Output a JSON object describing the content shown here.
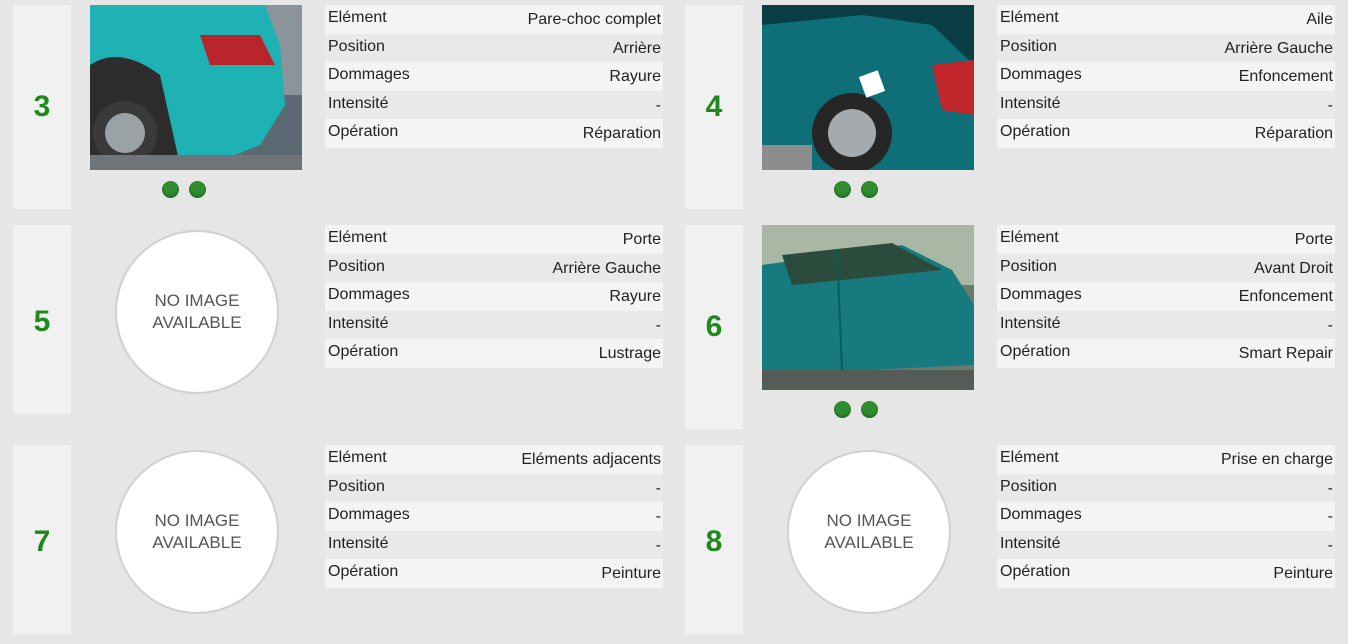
{
  "colors": {
    "accent": "#1e8a1e",
    "dot": "#2e8b2e"
  },
  "no_image": {
    "line1": "NO IMAGE",
    "line2": "AVAILABLE"
  },
  "cards": [
    {
      "number": "3",
      "has_photo": true,
      "photo_dots": 2,
      "rows": [
        {
          "label": "Elément",
          "value": "Pare-choc complet"
        },
        {
          "label": "Position",
          "value": "Arrière"
        },
        {
          "label": "Dommages",
          "value": "Rayure"
        },
        {
          "label": "Intensité",
          "value": "-"
        },
        {
          "label": "Opération",
          "value": "Réparation"
        }
      ]
    },
    {
      "number": "4",
      "has_photo": true,
      "photo_dots": 2,
      "rows": [
        {
          "label": "Elément",
          "value": "Aile"
        },
        {
          "label": "Position",
          "value": "Arrière Gauche"
        },
        {
          "label": "Dommages",
          "value": "Enfoncement"
        },
        {
          "label": "Intensité",
          "value": "-"
        },
        {
          "label": "Opération",
          "value": "Réparation"
        }
      ]
    },
    {
      "number": "5",
      "has_photo": false,
      "rows": [
        {
          "label": "Elément",
          "value": "Porte"
        },
        {
          "label": "Position",
          "value": "Arrière Gauche"
        },
        {
          "label": "Dommages",
          "value": "Rayure"
        },
        {
          "label": "Intensité",
          "value": "-"
        },
        {
          "label": "Opération",
          "value": "Lustrage"
        }
      ]
    },
    {
      "number": "6",
      "has_photo": true,
      "photo_dots": 2,
      "rows": [
        {
          "label": "Elément",
          "value": "Porte"
        },
        {
          "label": "Position",
          "value": "Avant Droit"
        },
        {
          "label": "Dommages",
          "value": "Enfoncement"
        },
        {
          "label": "Intensité",
          "value": "-"
        },
        {
          "label": "Opération",
          "value": "Smart Repair"
        }
      ]
    },
    {
      "number": "7",
      "has_photo": false,
      "rows": [
        {
          "label": "Elément",
          "value": "Eléments adjacents"
        },
        {
          "label": "Position",
          "value": "-"
        },
        {
          "label": "Dommages",
          "value": "-"
        },
        {
          "label": "Intensité",
          "value": "-"
        },
        {
          "label": "Opération",
          "value": "Peinture"
        }
      ]
    },
    {
      "number": "8",
      "has_photo": false,
      "rows": [
        {
          "label": "Elément",
          "value": "Prise en charge"
        },
        {
          "label": "Position",
          "value": "-"
        },
        {
          "label": "Dommages",
          "value": "-"
        },
        {
          "label": "Intensité",
          "value": "-"
        },
        {
          "label": "Opération",
          "value": "Peinture"
        }
      ]
    }
  ]
}
